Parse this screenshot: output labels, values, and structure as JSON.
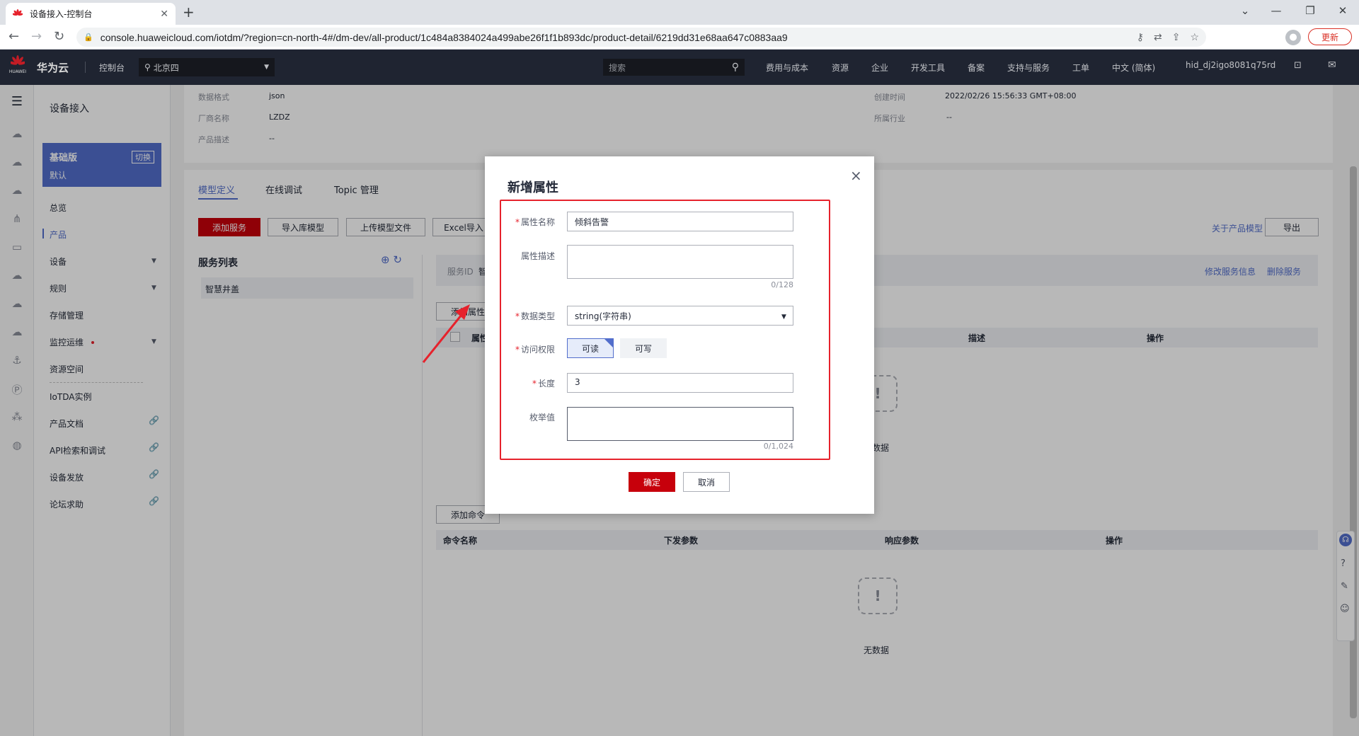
{
  "browser": {
    "tab_title": "设备接入-控制台",
    "url": "console.huaweicloud.com/iotdm/?region=cn-north-4#/dm-dev/all-product/1c484a8384024a499abe26f1f1b893dc/product-detail/6219dd31e68aa647c0883aa9",
    "update_label": "更新"
  },
  "header": {
    "logo_text": "HUAWEI",
    "brand": "华为云",
    "console": "控制台",
    "region": "北京四",
    "search_placeholder": "搜索",
    "nav": [
      "费用与成本",
      "资源",
      "企业",
      "开发工具",
      "备案",
      "支持与服务",
      "工单",
      "中文 (简体)",
      "hid_dj2igo8081q75rd"
    ]
  },
  "sidebar": {
    "title": "设备接入",
    "edition_name": "基础版",
    "edition_desc": "默认",
    "switch_label": "切换",
    "items": [
      "总览",
      "产品",
      "设备",
      "规则",
      "存储管理",
      "监控运维",
      "资源空间",
      "IoTDA实例",
      "产品文档",
      "API检索和调试",
      "设备发放",
      "论坛求助"
    ]
  },
  "product_info": {
    "labels": [
      "数据格式",
      "厂商名称",
      "产品描述",
      "创建时间",
      "所属行业"
    ],
    "values": [
      "json",
      "LZDZ",
      "--",
      "2022/02/26 15:56:33 GMT+08:00",
      "--"
    ]
  },
  "tabs": [
    "模型定义",
    "在线调试",
    "Topic 管理"
  ],
  "toolbar": {
    "add_service": "添加服务",
    "import_lib": "导入库模型",
    "upload_model": "上传模型文件",
    "excel_import": "Excel导入",
    "about_model": "关于产品模型",
    "export": "导出"
  },
  "service_list": {
    "title": "服务列表",
    "items": [
      "智慧井盖"
    ],
    "service_id_label": "服务ID",
    "service_id_value": "智",
    "modify": "修改服务信息",
    "delete": "删除服务",
    "add_property": "添加属性",
    "prop_cols": [
      "属性",
      "描述",
      "操作"
    ],
    "add_command": "添加命令",
    "cmd_cols": [
      "命令名称",
      "下发参数",
      "响应参数",
      "操作"
    ],
    "empty": "无数据",
    "empty_partial": "数据"
  },
  "modal": {
    "title": "新增属性",
    "name_label": "属性名称",
    "name_value": "倾斜告警",
    "desc_label": "属性描述",
    "desc_value": "",
    "desc_count": "0/128",
    "type_label": "数据类型",
    "type_value": "string(字符串)",
    "access_label": "访问权限",
    "access_read": "可读",
    "access_write": "可写",
    "length_label": "长度",
    "length_value": "3",
    "enum_label": "枚举值",
    "enum_value": "",
    "enum_count": "0/1,024",
    "ok": "确定",
    "cancel": "取消"
  },
  "colors": {
    "accent": "#526ecc",
    "primary_red": "#c7000b",
    "highlight_box": "#e6222c"
  }
}
